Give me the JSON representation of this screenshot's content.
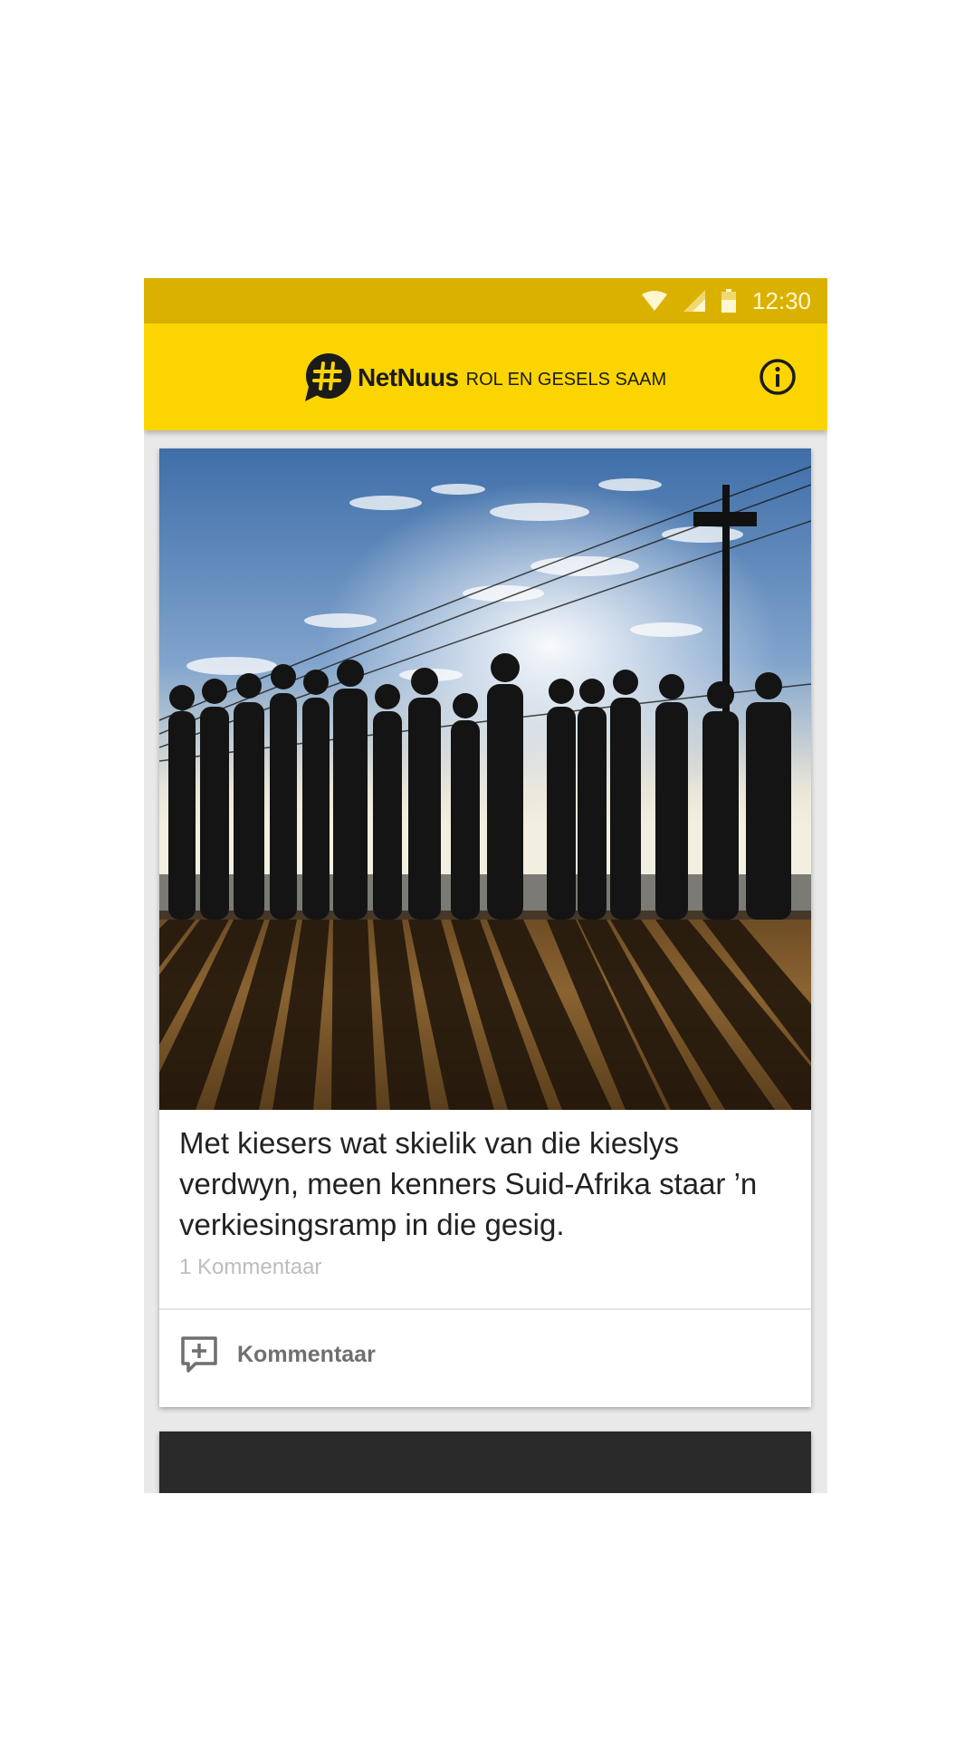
{
  "status_bar": {
    "time": "12:30",
    "icons": [
      "wifi-icon",
      "signal-icon",
      "battery-icon"
    ]
  },
  "app_bar": {
    "brand": "NetNuus",
    "tagline": "ROL EN GESELS SAAM",
    "logo_icon": "hashtag-speech-bubble-icon",
    "info_icon": "info-icon",
    "color": "#fcd500",
    "status_color": "#dbb100"
  },
  "feed": {
    "items": [
      {
        "image": "people-queuing-at-sunset-photo",
        "headline": "Met kiesers wat skielik van die kieslys verdwyn, meen kenners Suid-Afrika staar ’n verkiesingsramp in die gesig.",
        "comment_count": "1 Kommentaar",
        "comment_action": "Kommentaar",
        "comment_icon": "add-comment-icon"
      }
    ]
  }
}
